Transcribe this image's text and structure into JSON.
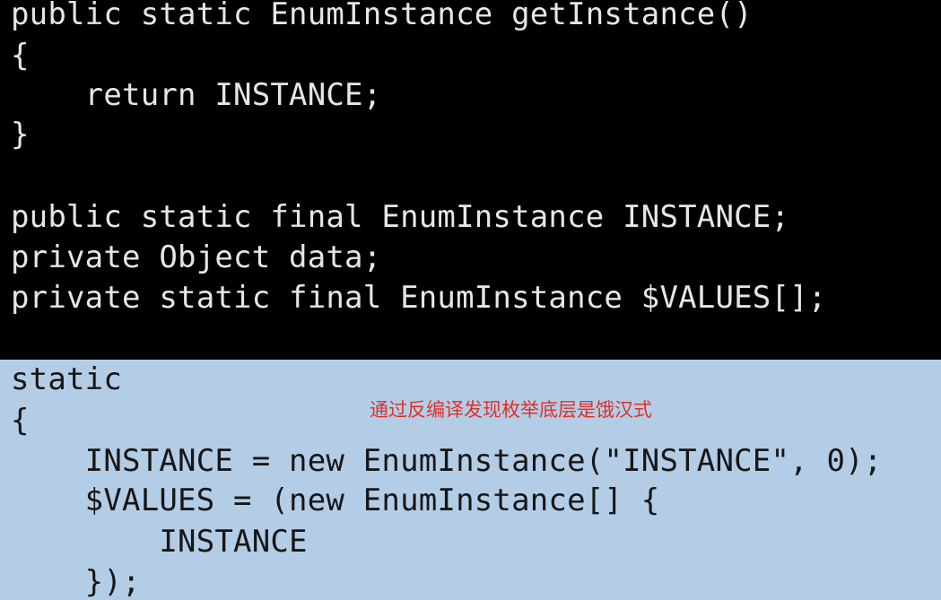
{
  "colors": {
    "top_background": "#000000",
    "top_text": "#e6e6e6",
    "bottom_background": "#b4cde6",
    "bottom_text": "#161616",
    "annotation": "#e0302a"
  },
  "code_top": [
    "public static EnumInstance getInstance()",
    "{",
    "    return INSTANCE;",
    "}",
    "",
    "public static final EnumInstance INSTANCE;",
    "private Object data;",
    "private static final EnumInstance $VALUES[];"
  ],
  "code_bottom": [
    "static",
    "{",
    "    INSTANCE = new EnumInstance(\"INSTANCE\", 0);",
    "    $VALUES = (new EnumInstance[] {",
    "        INSTANCE",
    "    });"
  ],
  "annotation": "通过反编译发现枚举底层是饿汉式"
}
